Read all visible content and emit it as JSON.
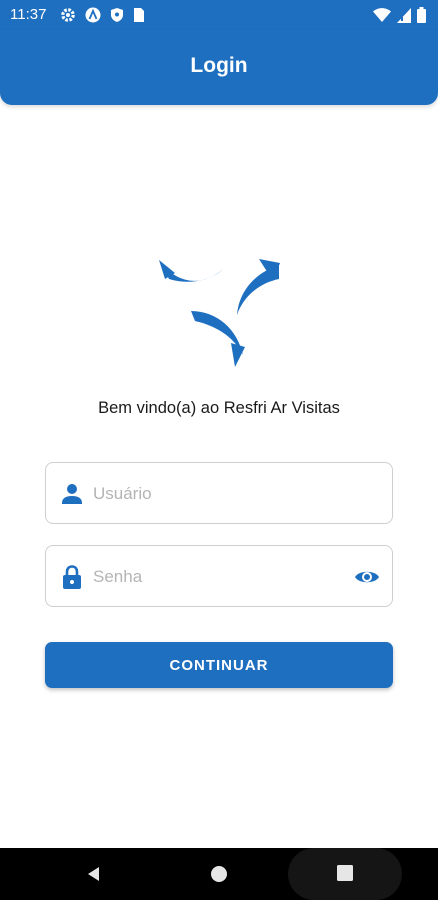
{
  "status_bar": {
    "time": "11:37",
    "left_icons": [
      "gear-icon",
      "a-icon",
      "shield-icon",
      "sim-icon"
    ],
    "right_icons": [
      "wifi-icon",
      "signal-icon",
      "battery-icon"
    ]
  },
  "app_bar": {
    "title": "Login"
  },
  "logo": {
    "name": "resfri-ar-logo",
    "color": "#1f6fc0"
  },
  "welcome_text": "Bem vindo(a) ao Resfri Ar Visitas",
  "form": {
    "username": {
      "placeholder": "Usuário",
      "value": "",
      "icon": "person-icon"
    },
    "password": {
      "placeholder": "Senha",
      "value": "",
      "icon": "lock-icon",
      "toggle_icon": "eye-icon"
    },
    "submit_label": "CONTINUAR"
  },
  "nav_bar": {
    "buttons": [
      "back-icon",
      "home-icon",
      "recents-icon"
    ]
  },
  "colors": {
    "primary": "#1f6fc0",
    "background": "#ffffff",
    "border": "#cfcfcf",
    "placeholder": "#b4b4b4"
  }
}
